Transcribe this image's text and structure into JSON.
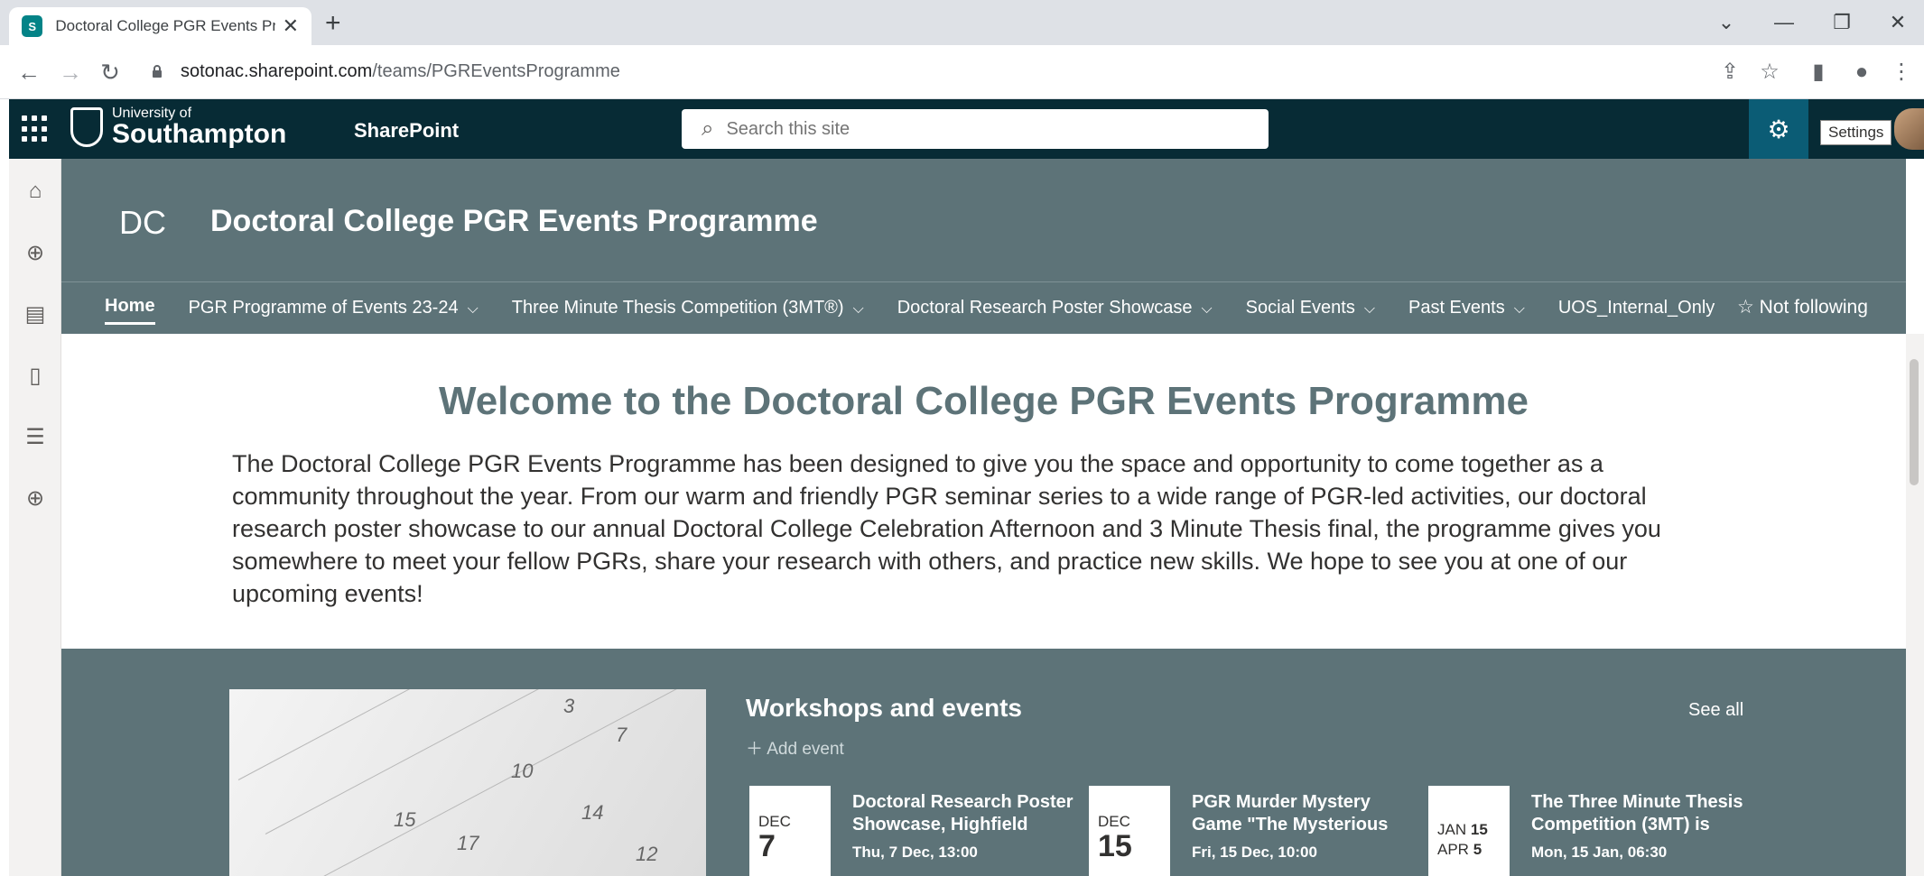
{
  "browser": {
    "tab_title": "Doctoral College PGR Events Pro",
    "tab_favicon": "S",
    "url_host": "sotonac.sharepoint.com",
    "url_path": "/teams/PGREventsProgramme"
  },
  "suitebar": {
    "logo_small": "University of",
    "logo_big": "Southampton",
    "app_name": "SharePoint",
    "search_placeholder": "Search this site",
    "settings_tooltip": "Settings"
  },
  "site": {
    "logo_initials": "DC",
    "title": "Doctoral College PGR Events Programme",
    "nav": [
      {
        "label": "Home"
      },
      {
        "label": "PGR Programme of Events 23-24"
      },
      {
        "label": "Three Minute Thesis Competition (3MT®)"
      },
      {
        "label": "Doctoral Research Poster Showcase"
      },
      {
        "label": "Social Events"
      },
      {
        "label": "Past Events"
      },
      {
        "label": "UOS_Internal_Only"
      }
    ],
    "follow_label": "Not following"
  },
  "content": {
    "welcome_title": "Welcome to the Doctoral College PGR Events Programme",
    "intro_text": "The Doctoral College PGR Events Programme has been designed to give you the space and opportunity to come together as a community throughout the year. From our warm and friendly PGR seminar series to a wide range of PGR-led activities, our doctoral research poster showcase to our annual Doctoral College Celebration Afternoon and 3 Minute Thesis final, the programme gives you somewhere to meet your fellow PGRs, share your research with others, and practice new skills. We hope to see you at one of our upcoming events!"
  },
  "events": {
    "title": "Workshops and events",
    "see_all": "See all",
    "add_event": "Add event",
    "calendar_numbers": [
      "3",
      "7",
      "10",
      "14",
      "15",
      "17",
      "12"
    ],
    "items": [
      {
        "month": "DEC",
        "day": "7",
        "title": "Doctoral Research Poster Showcase, Highfield",
        "when": "Thu, 7 Dec, 13:00"
      },
      {
        "month": "DEC",
        "day": "15",
        "title": "PGR Murder Mystery Game \"The Mysterious",
        "when": "Fri, 15 Dec, 10:00"
      },
      {
        "range_start_month": "JAN",
        "range_start_day": "15",
        "range_end_month": "APR",
        "range_end_day": "5",
        "title": "The Three Minute Thesis Competition (3MT) is",
        "when": "Mon, 15 Jan, 06:30"
      }
    ]
  }
}
